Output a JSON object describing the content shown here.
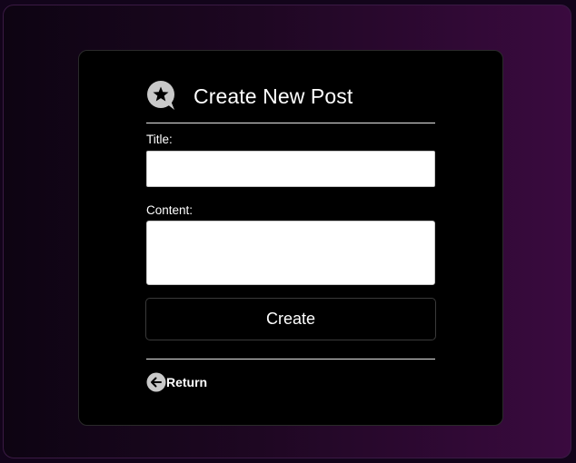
{
  "form": {
    "title": "Create New Post",
    "header_icon": "star-chat-bubble-icon",
    "title_label": "Title:",
    "title_value": "",
    "content_label": "Content:",
    "content_value": "",
    "create_label": "Create",
    "return_label": "Return",
    "return_icon": "arrow-left-circle-icon"
  },
  "colors": {
    "card_background": "#000000",
    "text": "#ffffff",
    "icon": "#c9c9c9",
    "page_gradient_start": "#0d0412",
    "page_gradient_end": "#3a0a3f"
  }
}
